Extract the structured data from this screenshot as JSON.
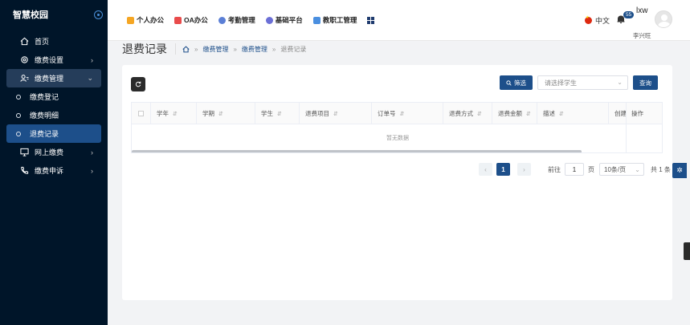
{
  "sidebar": {
    "brand": "智慧校园",
    "menu": [
      {
        "label": "首页",
        "icon": "home-icon"
      },
      {
        "label": "缴费设置",
        "icon": "gear-icon"
      },
      {
        "label": "缴费管理",
        "icon": "user-list-icon"
      },
      {
        "label": "网上缴费",
        "icon": "monitor-icon"
      },
      {
        "label": "缴费申诉",
        "icon": "phone-icon"
      }
    ],
    "submenu": [
      {
        "label": "缴费登记"
      },
      {
        "label": "缴费明细"
      },
      {
        "label": "退费记录"
      }
    ]
  },
  "topnav": [
    {
      "label": "个人办公",
      "color": "#f5a623"
    },
    {
      "label": "OA办公",
      "color": "#e94b4b"
    },
    {
      "label": "考勤管理",
      "color": "#5b7fd6"
    },
    {
      "label": "基础平台",
      "color": "#6b6fd6"
    },
    {
      "label": "教职工管理",
      "color": "#4a8fe0"
    }
  ],
  "header": {
    "language": "中文",
    "notification_count": "55",
    "username": "lxw",
    "realname": "李兴旺"
  },
  "page": {
    "title": "退费记录",
    "breadcrumb": [
      "缴费管理",
      "缴费管理",
      "退费记录"
    ]
  },
  "toolbar": {
    "filter_label": "筛选",
    "student_placeholder": "请选择学生",
    "query_label": "查询"
  },
  "table": {
    "columns": [
      "学年",
      "学期",
      "学生",
      "退费项目",
      "订单号",
      "退费方式",
      "退费金额",
      "描述",
      "创建",
      "操作"
    ],
    "empty_text": "暂无数据"
  },
  "pager": {
    "current_page": "1",
    "goto_label": "前往",
    "goto_value": "1",
    "page_unit": "页",
    "page_size": "10条/页",
    "total": "共 1 条"
  },
  "colors": {
    "sidebar_bg": "#001529",
    "primary": "#1d4f8a"
  }
}
